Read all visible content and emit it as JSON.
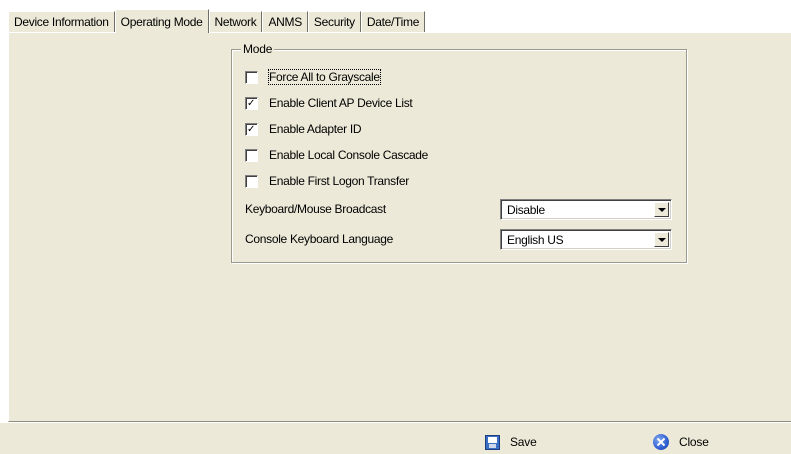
{
  "tabs": [
    {
      "label": "Device Information",
      "active": false
    },
    {
      "label": "Operating Mode",
      "active": true
    },
    {
      "label": "Network",
      "active": false
    },
    {
      "label": "ANMS",
      "active": false
    },
    {
      "label": "Security",
      "active": false
    },
    {
      "label": "Date/Time",
      "active": false
    }
  ],
  "mode_group": {
    "title": "Mode",
    "options": [
      {
        "label": "Force All to Grayscale",
        "checked": false
      },
      {
        "label": "Enable Client AP Device List",
        "checked": true
      },
      {
        "label": "Enable Adapter ID",
        "checked": true
      },
      {
        "label": "Enable Local Console Cascade",
        "checked": false
      },
      {
        "label": "Enable First Logon Transfer",
        "checked": false
      }
    ],
    "fields": [
      {
        "label": "Keyboard/Mouse Broadcast",
        "value": "Disable"
      },
      {
        "label": "Console Keyboard Language",
        "value": "English US"
      }
    ]
  },
  "actions": {
    "save_label": "Save",
    "close_label": "Close"
  },
  "icons": {
    "save": "floppy-disk-icon",
    "close": "close-circle-icon",
    "dropdown": "chevron-down-icon"
  },
  "colors": {
    "panel_bg": "#ece9d8",
    "window_bg": "#ffffff",
    "save_icon": "#3a6fc4",
    "close_icon": "#2f5fd0"
  }
}
